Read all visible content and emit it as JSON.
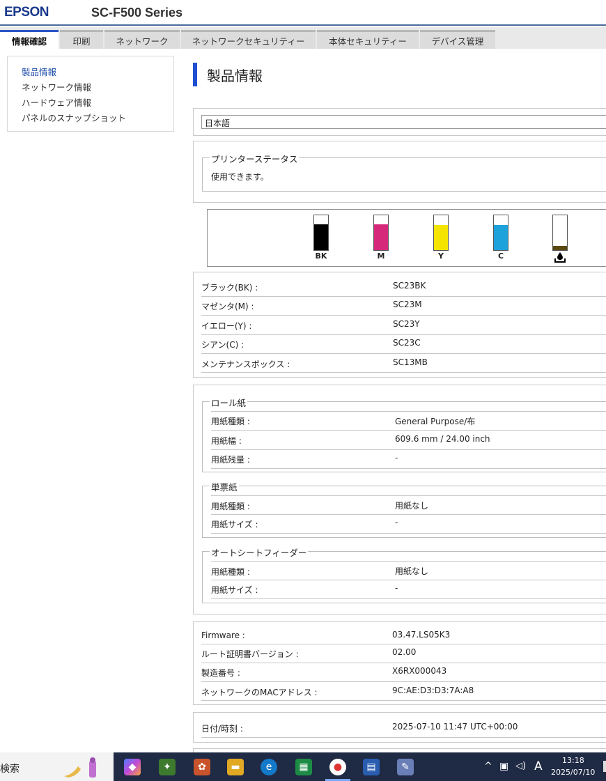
{
  "header": {
    "brand": "EPSON",
    "model": "SC-F500 Series"
  },
  "tabs": [
    {
      "label": "情報確認",
      "active": true
    },
    {
      "label": "印刷"
    },
    {
      "label": "ネットワーク"
    },
    {
      "label": "ネットワークセキュリティー"
    },
    {
      "label": "本体セキュリティー"
    },
    {
      "label": "デバイス管理"
    }
  ],
  "sidebar": {
    "items": [
      {
        "label": "製品情報",
        "active": true
      },
      {
        "label": "ネットワーク情報"
      },
      {
        "label": "ハードウェア情報"
      },
      {
        "label": "パネルのスナップショット"
      }
    ]
  },
  "page_title": "製品情報",
  "language": {
    "selected": "日本語"
  },
  "status": {
    "legend": "プリンターステータス",
    "text": "使用できます。"
  },
  "ink_levels": [
    {
      "label": "BK",
      "color": "#000000",
      "level": 0.75
    },
    {
      "label": "M",
      "color": "#d6287a",
      "level": 0.75
    },
    {
      "label": "Y",
      "color": "#f4e400",
      "level": 0.72
    },
    {
      "label": "C",
      "color": "#1da2dc",
      "level": 0.72
    },
    {
      "label": "",
      "color": "#5a4a10",
      "level": 0.12,
      "icon": "maintenance-box-icon"
    }
  ],
  "cartridges": [
    {
      "label": "ブラック(BK) :",
      "value": "SC23BK"
    },
    {
      "label": "マゼンタ(M) :",
      "value": "SC23M"
    },
    {
      "label": "イエロー(Y) :",
      "value": "SC23Y"
    },
    {
      "label": "シアン(C) :",
      "value": "SC23C"
    },
    {
      "label": "メンテナンスボックス :",
      "value": "SC13MB"
    }
  ],
  "paper": {
    "roll": {
      "legend": "ロール紙",
      "rows": [
        {
          "label": "用紙種類 :",
          "value": "General Purpose/布"
        },
        {
          "label": "用紙幅 :",
          "value": "609.6 mm / 24.00 inch"
        },
        {
          "label": "用紙残量 :",
          "value": "-"
        }
      ]
    },
    "cut": {
      "legend": "単票紙",
      "rows": [
        {
          "label": "用紙種類 :",
          "value": "用紙なし"
        },
        {
          "label": "用紙サイズ :",
          "value": "-"
        }
      ]
    },
    "feeder": {
      "legend": "オートシートフィーダー",
      "rows": [
        {
          "label": "用紙種類 :",
          "value": "用紙なし"
        },
        {
          "label": "用紙サイズ :",
          "value": "-"
        }
      ]
    }
  },
  "device": [
    {
      "label": "Firmware :",
      "value": "03.47.LS05K3"
    },
    {
      "label": "ルート証明書バージョン :",
      "value": "02.00"
    },
    {
      "label": "製造番号 :",
      "value": "X6RX000043"
    },
    {
      "label": "ネットワークのMACアドレス :",
      "value": "9C:AE:D3:D3:7A:A8"
    }
  ],
  "datetime": {
    "label": "日付/時刻 :",
    "value": "2025-07-10 11:47 UTC+00:00"
  },
  "taskbar": {
    "search": "検索",
    "ime": "A",
    "time": "13:18",
    "date": "2025/07/10"
  }
}
